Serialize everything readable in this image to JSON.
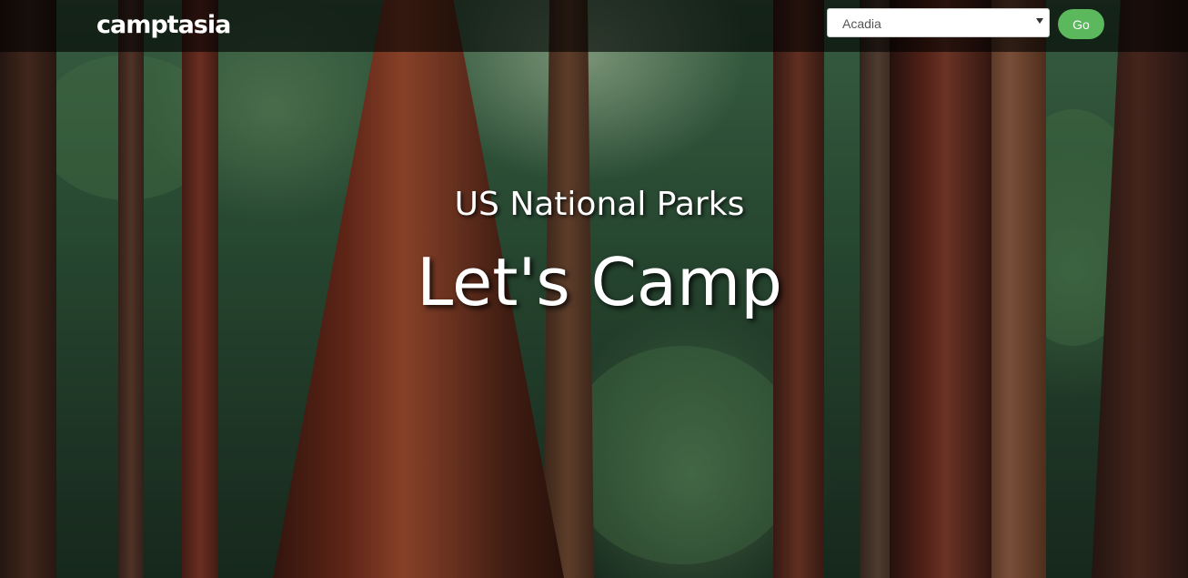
{
  "brand": {
    "logo_text": "camptasia"
  },
  "park_select": {
    "selected": "Acadia"
  },
  "go_button": {
    "label": "Go"
  },
  "hero": {
    "subtitle": "US National Parks",
    "title": "Let's Camp"
  },
  "colors": {
    "go_button": "#5cb85c",
    "navbar_overlay": "rgba(0,0,0,0.62)",
    "text": "#ffffff"
  },
  "icons": {
    "select_caret": "caret-down-icon"
  }
}
